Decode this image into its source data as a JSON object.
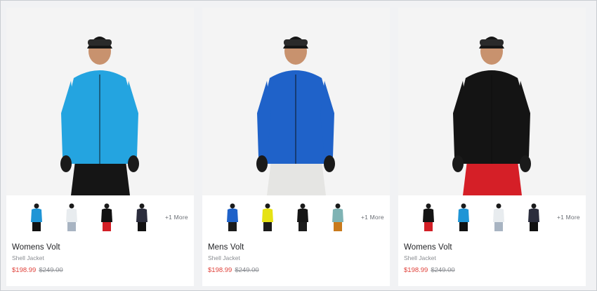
{
  "colors": {
    "sale": "#e0423b",
    "muted": "#8a8d92",
    "text": "#1e1f22",
    "background": "#f4f4f4"
  },
  "products": [
    {
      "name": "Womens Volt",
      "type": "Shell Jacket",
      "sale_price": "$198.99",
      "original_price": "$249.00",
      "more_label": "+1 More",
      "jacket_color": "#24a4e0",
      "pants_color": "#151515",
      "swatches": [
        "#1f95d6",
        "#e8ecef",
        "#111111",
        "#2b2d3c"
      ],
      "swatch_pants": [
        "#111111",
        "#a8b4c2",
        "#d21f26",
        "#111111"
      ]
    },
    {
      "name": "Mens Volt",
      "type": "Shell Jacket",
      "sale_price": "$198.99",
      "original_price": "$249.00",
      "more_label": "+1 More",
      "jacket_color": "#1f62c9",
      "pants_color": "#e5e5e3",
      "swatches": [
        "#1f62c9",
        "#e6e214",
        "#151515",
        "#7fb3b4"
      ],
      "swatch_pants": [
        "#1b1b1b",
        "#1b1b1b",
        "#1b1b1b",
        "#c97a1c"
      ]
    },
    {
      "name": "Womens Volt",
      "type": "Shell Jacket",
      "sale_price": "$198.99",
      "original_price": "$249.00",
      "more_label": "+1 More",
      "jacket_color": "#141414",
      "pants_color": "#d51f27",
      "swatches": [
        "#141414",
        "#1f95d6",
        "#e8ecef",
        "#2b2d3c"
      ],
      "swatch_pants": [
        "#d21f26",
        "#111111",
        "#a8b4c2",
        "#111111"
      ]
    }
  ]
}
